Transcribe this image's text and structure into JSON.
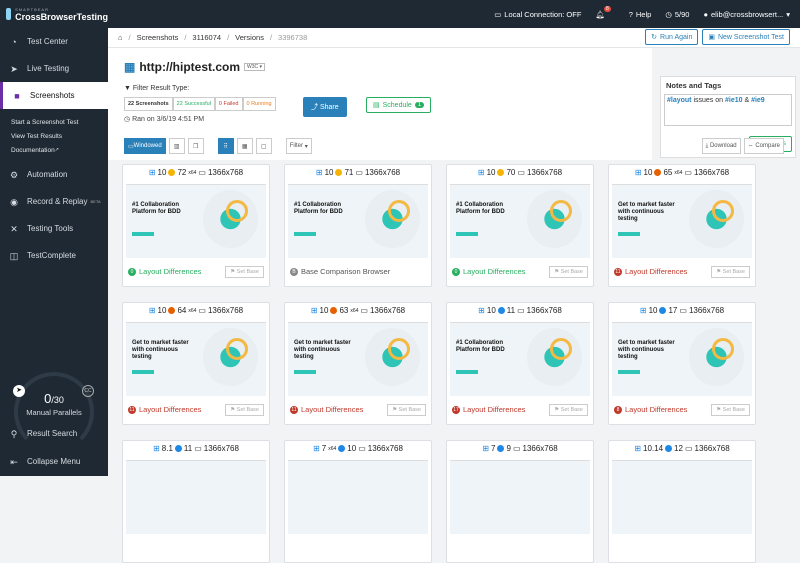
{
  "brand": {
    "small": "SMARTBEAR",
    "name": "CrossBrowserTesting"
  },
  "topbar": {
    "local_connection": "Local Connection: OFF",
    "notif_count": "8",
    "help": "Help",
    "minutes": "5/90",
    "user": "elib@crossbrowsert..."
  },
  "sidebar": {
    "items": [
      {
        "label": "Test Center"
      },
      {
        "label": "Live Testing"
      },
      {
        "label": "Screenshots"
      }
    ],
    "subitems": [
      "Start a Screenshot Test",
      "View Test Results",
      "Documentation"
    ],
    "items2": [
      {
        "label": "Automation"
      },
      {
        "label": "Record & Replay",
        "badge": "BETA"
      },
      {
        "label": "Testing Tools"
      },
      {
        "label": "TestComplete"
      }
    ],
    "parallels_used": "0",
    "parallels_total": "/30",
    "parallels_label": "Manual Parallels",
    "result_search": "Result Search",
    "collapse": "Collapse Menu"
  },
  "breadcrumb": {
    "home": "⌂",
    "screenshots": "Screenshots",
    "id": "3116074",
    "versions": "Versions",
    "version_id": "3396738"
  },
  "actions": {
    "run_again": "Run Again",
    "new_test": "New Screenshot Test"
  },
  "header": {
    "url": "http://hiptest.com",
    "w3c": "W3C",
    "filter_title": "Filter Result Type:",
    "filters": [
      "22 Screenshots",
      "22 Successful",
      "0 Failed",
      "0 Running"
    ],
    "ran": "Ran on 3/6/19 4:51 PM",
    "share": "Share",
    "schedule": "Schedule",
    "schedule_count": "1"
  },
  "notes": {
    "title": "Notes and Tags",
    "tag1": "#layout",
    "mid": " issues on ",
    "tag2": "#ie10",
    "amp": " & ",
    "tag3": "#ie9",
    "save": "Save Notes"
  },
  "toolbar": {
    "windowed": "Windowed",
    "filter": "Filter",
    "download": "Download",
    "compare": "Compare"
  },
  "cards": [
    {
      "os": "10",
      "browser": "72",
      "suffix": "x64",
      "res": "1366x768",
      "bcolor": "#f4b400",
      "count": "0",
      "label": "Layout Differences",
      "status": "green",
      "setbase": "Set Base",
      "hero": "#1 Collaboration Platform for BDD"
    },
    {
      "os": "10",
      "browser": "71",
      "suffix": "",
      "res": "1366x768",
      "bcolor": "#f4b400",
      "count": "B",
      "label": "Base Comparison Browser",
      "status": "gray",
      "setbase": "",
      "hero": "#1 Collaboration Platform for BDD"
    },
    {
      "os": "10",
      "browser": "70",
      "suffix": "",
      "res": "1366x768",
      "bcolor": "#f4b400",
      "count": "0",
      "label": "Layout Differences",
      "status": "green",
      "setbase": "Set Base",
      "hero": "#1 Collaboration Platform for BDD"
    },
    {
      "os": "10",
      "browser": "65",
      "suffix": "x64",
      "res": "1366x768",
      "bcolor": "#e66000",
      "count": "11",
      "label": "Layout Differences",
      "status": "red",
      "setbase": "Set Base",
      "hero": "Get to market faster with continuous testing"
    },
    {
      "os": "10",
      "browser": "64",
      "suffix": "x64",
      "res": "1366x768",
      "bcolor": "#e66000",
      "count": "11",
      "label": "Layout Differences",
      "status": "red",
      "setbase": "Set Base",
      "hero": "Get to market faster with continuous testing"
    },
    {
      "os": "10",
      "browser": "63",
      "suffix": "x64",
      "res": "1366x768",
      "bcolor": "#e66000",
      "count": "11",
      "label": "Layout Differences",
      "status": "red",
      "setbase": "Set Base",
      "hero": "Get to market faster with continuous testing"
    },
    {
      "os": "10",
      "browser": "11",
      "suffix": "",
      "res": "1366x768",
      "bcolor": "#1e88e5",
      "count": "17",
      "label": "Layout Differences",
      "status": "red",
      "setbase": "Set Base",
      "hero": "#1 Collaboration Platform for BDD"
    },
    {
      "os": "10",
      "browser": "17",
      "suffix": "",
      "res": "1366x768",
      "bcolor": "#1e88e5",
      "count": "8",
      "label": "Layout Differences",
      "status": "red",
      "setbase": "Set Base",
      "hero": "Get to market faster with continuous testing"
    },
    {
      "os": "8.1",
      "browser": "11",
      "suffix": "",
      "res": "1366x768",
      "bcolor": "#1e88e5"
    },
    {
      "os": "7",
      "ossuffix": "x64",
      "browser": "10",
      "suffix": "",
      "res": "1366x768",
      "bcolor": "#1e88e5"
    },
    {
      "os": "7",
      "browser": "9",
      "suffix": "",
      "res": "1366x768",
      "bcolor": "#1e88e5"
    },
    {
      "os": "10.14",
      "browser": "12",
      "suffix": "",
      "res": "1366x768",
      "bcolor": "#1e88e5"
    }
  ]
}
